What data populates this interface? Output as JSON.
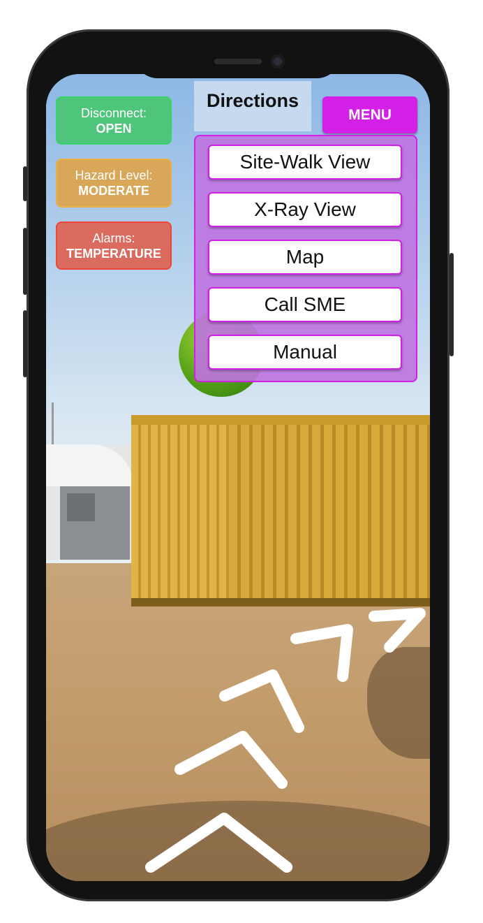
{
  "status": {
    "disconnect": {
      "label": "Disconnect:",
      "value": "OPEN",
      "color": "#4ec57b"
    },
    "hazard": {
      "label": "Hazard Level:",
      "value": "MODERATE",
      "color": "#d8a75a"
    },
    "alarms": {
      "label": "Alarms:",
      "value": "TEMPERATURE",
      "color": "#db6b5e"
    }
  },
  "header": {
    "title": "Directions"
  },
  "menu": {
    "button_label": "MENU",
    "accent_color": "#d220e6",
    "items": [
      {
        "label": "Site-Walk View"
      },
      {
        "label": "X-Ray View"
      },
      {
        "label": "Map"
      },
      {
        "label": "Call SME"
      },
      {
        "label": "Manual"
      }
    ]
  },
  "icons": [
    "direction-chevron-icon",
    "waypoint-marker-icon"
  ]
}
